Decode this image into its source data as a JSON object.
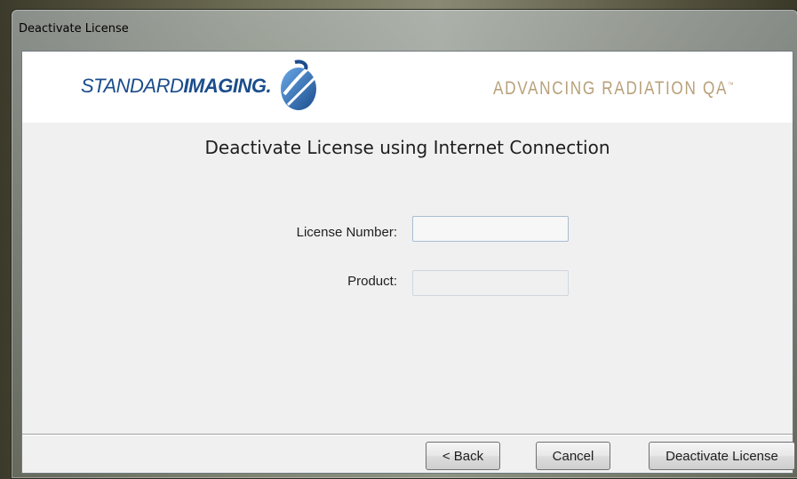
{
  "window": {
    "title": "Deactivate License"
  },
  "banner": {
    "logo_regular": "STANDARD",
    "logo_bold": "IMAGING",
    "logo_dot": ".",
    "tagline": "ADVANCING RADIATION QA",
    "tagline_mark": "™",
    "logo_icon": "swoosh-globe-icon"
  },
  "main": {
    "heading": "Deactivate License using Internet Connection",
    "license_label": "License Number:",
    "license_value": "",
    "product_label": "Product:",
    "product_value": ""
  },
  "buttons": {
    "back": "< Back",
    "cancel": "Cancel",
    "deactivate": "Deactivate License"
  },
  "colors": {
    "brand_blue": "#1b4d8c",
    "tagline_gold": "#b8a17a"
  }
}
